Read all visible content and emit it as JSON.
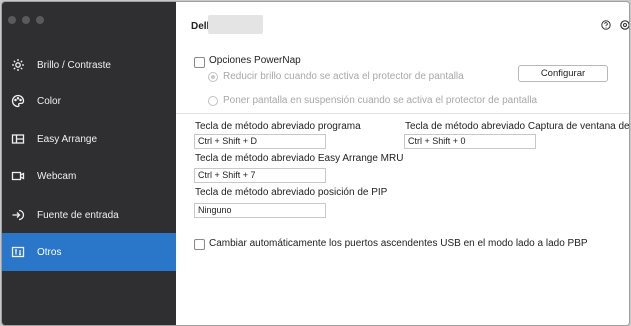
{
  "sidebar": {
    "items": [
      {
        "label": "Brillo / Contraste",
        "icon": "brightness-icon"
      },
      {
        "label": "Color",
        "icon": "palette-icon"
      },
      {
        "label": "Easy Arrange",
        "icon": "layout-icon"
      },
      {
        "label": "Webcam",
        "icon": "webcam-icon"
      },
      {
        "label": "Fuente de entrada",
        "icon": "input-source-icon"
      },
      {
        "label": "Otros",
        "icon": "others-icon",
        "active": true
      }
    ]
  },
  "header": {
    "model": "Dell"
  },
  "powernap": {
    "label": "Opciones PowerNap",
    "option1": "Reducir brillo cuando se activa el protector de pantalla",
    "option2": "Poner pantalla en suspensión cuando se activa el protector de pantalla",
    "configure_button": "Configurar"
  },
  "shortcuts": {
    "program_label": "Tecla de método abreviado programa",
    "program_value": "Ctrl + Shift + D",
    "capture_label": "Tecla de método abreviado Captura de ventana de...",
    "capture_value": "Ctrl + Shift + 0",
    "easy_arrange_label": "Tecla de método abreviado Easy Arrange MRU",
    "easy_arrange_value": "Ctrl + Shift + 7",
    "pip_label": "Tecla de método abreviado posición de PIP",
    "pip_value": "Ninguno"
  },
  "usb": {
    "label": "Cambiar automáticamente los puertos ascendentes USB en el modo lado a lado PBP"
  },
  "colors": {
    "sidebar_bg": "#2f2f31",
    "active_bg": "#2a76c9"
  }
}
